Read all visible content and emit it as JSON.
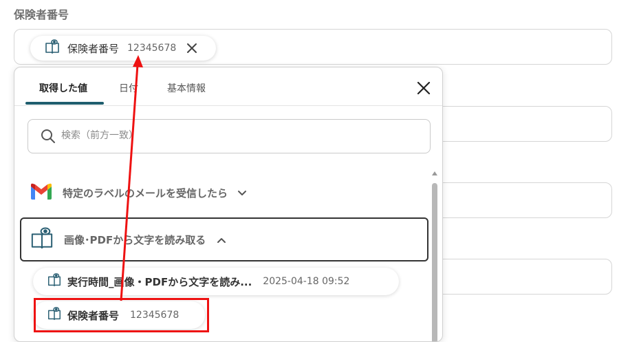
{
  "field": {
    "label": "保険者番号",
    "chip": {
      "name": "保険者番号",
      "value": "12345678"
    }
  },
  "panel": {
    "tabs": [
      {
        "label": "取得した値",
        "active": true
      },
      {
        "label": "日付",
        "active": false
      },
      {
        "label": "基本情報",
        "active": false
      }
    ],
    "search": {
      "placeholder": "検索（前方一致）",
      "value": ""
    },
    "sections": [
      {
        "label": "特定のラベルのメールを受信したら",
        "icon": "gmail-icon",
        "expanded": false
      },
      {
        "label": "画像･PDFから文字を読み取る",
        "icon": "ocr-book-icon",
        "expanded": true
      }
    ],
    "items": [
      {
        "name": "実行時間_画像・PDFから文字を読み...",
        "value": "2025-04-18 09:52"
      },
      {
        "name": "保険者番号",
        "value": "12345678",
        "highlighted": true
      }
    ]
  },
  "colors": {
    "accent": "#1f5e6e",
    "highlight": "#ee1111",
    "arrow": "#ee1111"
  }
}
